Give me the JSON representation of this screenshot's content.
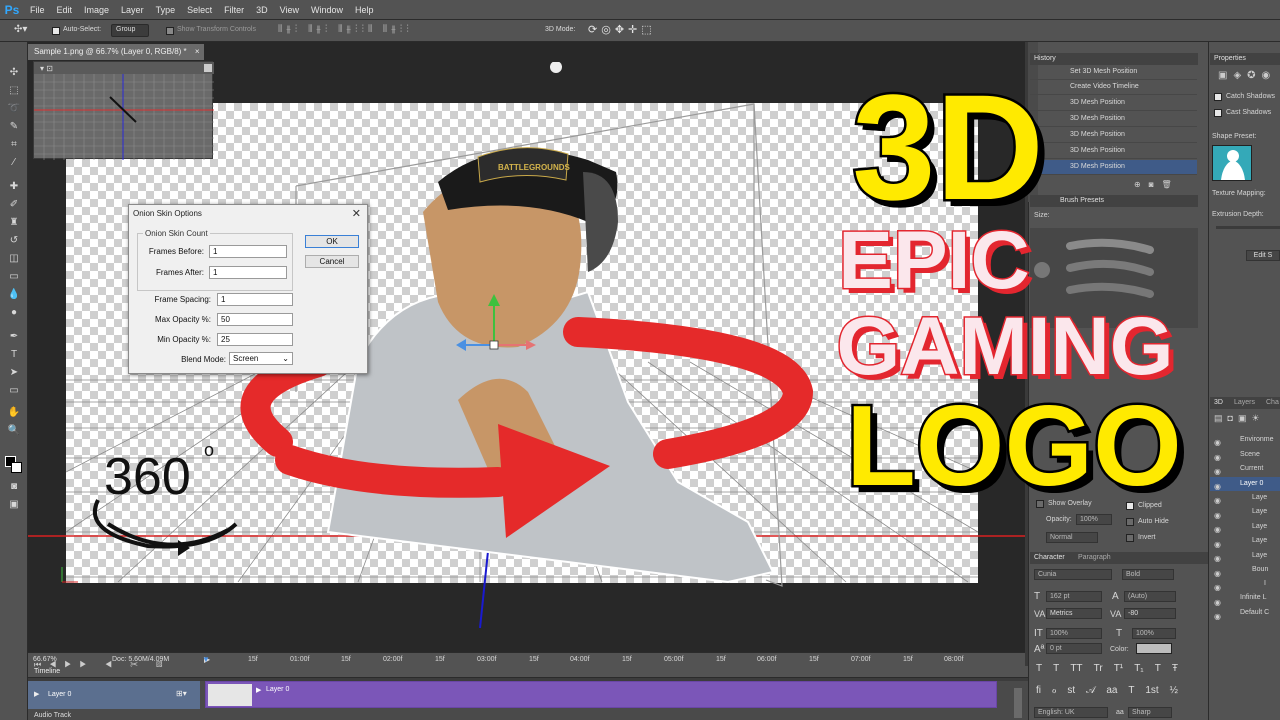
{
  "app": {
    "logo": "Ps"
  },
  "menu": [
    "File",
    "Edit",
    "Image",
    "Layer",
    "Type",
    "Select",
    "Filter",
    "3D",
    "View",
    "Window",
    "Help"
  ],
  "options": {
    "auto_select": "Auto-Select:",
    "group_value": "Group",
    "show_transform": "Show Transform Controls",
    "mode_3d": "3D Mode:"
  },
  "document": {
    "tab_title": "Sample 1.png @ 66.7% (Layer 0, RGB/8) *",
    "tab_close": "×"
  },
  "dialog": {
    "title": "Onion Skin Options",
    "close": "✕",
    "group_label": "Onion Skin Count",
    "frames_before_label": "Frames Before:",
    "frames_before": "1",
    "frames_after_label": "Frames After:",
    "frames_after": "1",
    "frame_spacing_label": "Frame Spacing:",
    "frame_spacing": "1",
    "max_opacity_label": "Max Opacity %:",
    "max_opacity": "50",
    "min_opacity_label": "Min Opacity %:",
    "min_opacity": "25",
    "blend_mode_label": "Blend Mode:",
    "blend_mode": "Screen",
    "ok": "OK",
    "cancel": "Cancel"
  },
  "overlay": {
    "line1": "3D",
    "line2": "EPIC",
    "line3": "GAMING",
    "line4": "LOGO",
    "degrees": "360",
    "degree_sign": "o",
    "cap_text": "BATTLEGROUNDS"
  },
  "status": {
    "zoom": "66.67%",
    "doc": "Doc: 5.60M/4.09M"
  },
  "timeline": {
    "title": "Timeline",
    "ruler": [
      "15f",
      "01:00f",
      "15f",
      "02:00f",
      "15f",
      "03:00f",
      "15f",
      "04:00f",
      "15f",
      "05:00f",
      "15f",
      "06:00f",
      "15f",
      "07:00f",
      "15f",
      "08:00f"
    ],
    "layer": "Layer 0",
    "clip": "Layer 0",
    "second_layer": "Audio Track"
  },
  "history": {
    "title": "History",
    "items": [
      "Set 3D Mesh Position",
      "Create Video Timeline",
      "3D Mesh Position",
      "3D Mesh Position",
      "3D Mesh Position",
      "3D Mesh Position",
      "3D Mesh Position"
    ]
  },
  "brush": {
    "title": "Brush Presets",
    "size": "Size:"
  },
  "properties": {
    "title": "Properties",
    "catch_shadows": "Catch Shadows",
    "cast_shadows": "Cast Shadows",
    "shape_preset": "Shape Preset:",
    "texture_mapping": "Texture Mapping:",
    "extrusion_depth": "Extrusion Depth:",
    "edit": "Edit S"
  },
  "layers3d": {
    "tabs": [
      "3D",
      "Layers",
      "Cha"
    ],
    "items": [
      "Environme",
      "Scene",
      "Current",
      "Layer 0",
      "Laye",
      "Laye",
      "Laye",
      "Laye",
      "Laye",
      "Boun",
      "I",
      "Infinite L",
      "Default C"
    ]
  },
  "mid_panel": {
    "show_overlay": "Show Overlay",
    "clipped": "Clipped",
    "opacity": "Opacity:",
    "opacity_val": "100%",
    "auto_hide": "Auto Hide",
    "normal": "Normal",
    "invert": "Invert"
  },
  "character": {
    "tabs": [
      "Character",
      "Paragraph"
    ],
    "font": "Cunia",
    "style": "Bold",
    "size": "162 pt",
    "leading": "(Auto)",
    "kerning": "Metrics",
    "tracking": "-80",
    "v_scale": "100%",
    "h_scale": "100%",
    "baseline": "0 pt",
    "color_label": "Color:",
    "glyphs": [
      "T",
      "T",
      "TT",
      "Tr",
      "T¹",
      "T₁",
      "T",
      "Ŧ"
    ],
    "glyphs2": [
      "fi",
      "ℴ",
      "st",
      "𝒜",
      "aa",
      "T",
      "1st",
      "½"
    ],
    "lang": "English: UK",
    "aa": "aa",
    "sharp": "Sharp"
  }
}
